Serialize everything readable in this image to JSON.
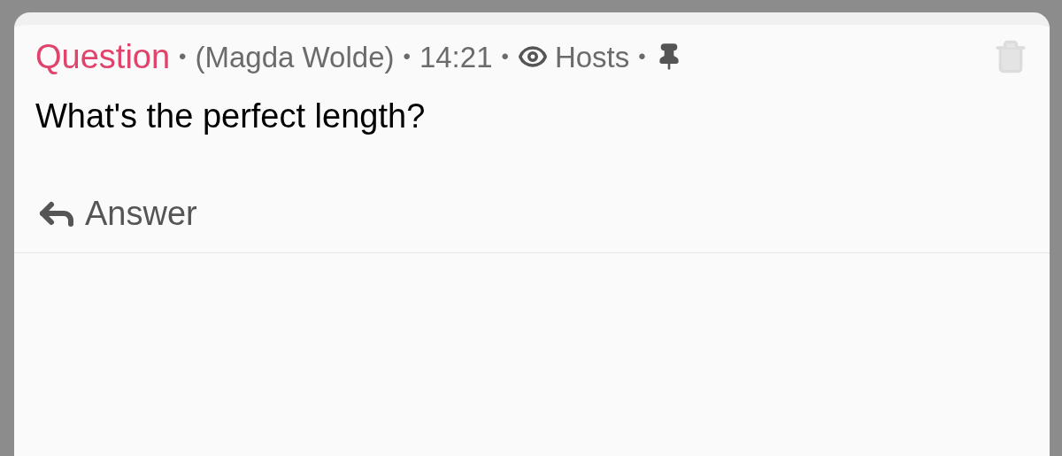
{
  "post": {
    "label": "Question",
    "meta": [
      {
        "kind": "author",
        "bullet": "•",
        "text": "(Magda Wolde)"
      },
      {
        "kind": "time",
        "bullet": "•",
        "text": "14:21"
      },
      {
        "kind": "visibility",
        "bullet": "•",
        "text": "Hosts"
      },
      {
        "kind": "pin",
        "bullet": "•"
      }
    ],
    "pinned": true,
    "text": "What's the perfect length?",
    "actions": [
      {
        "kind": "reply",
        "label": "Answer"
      }
    ]
  }
}
